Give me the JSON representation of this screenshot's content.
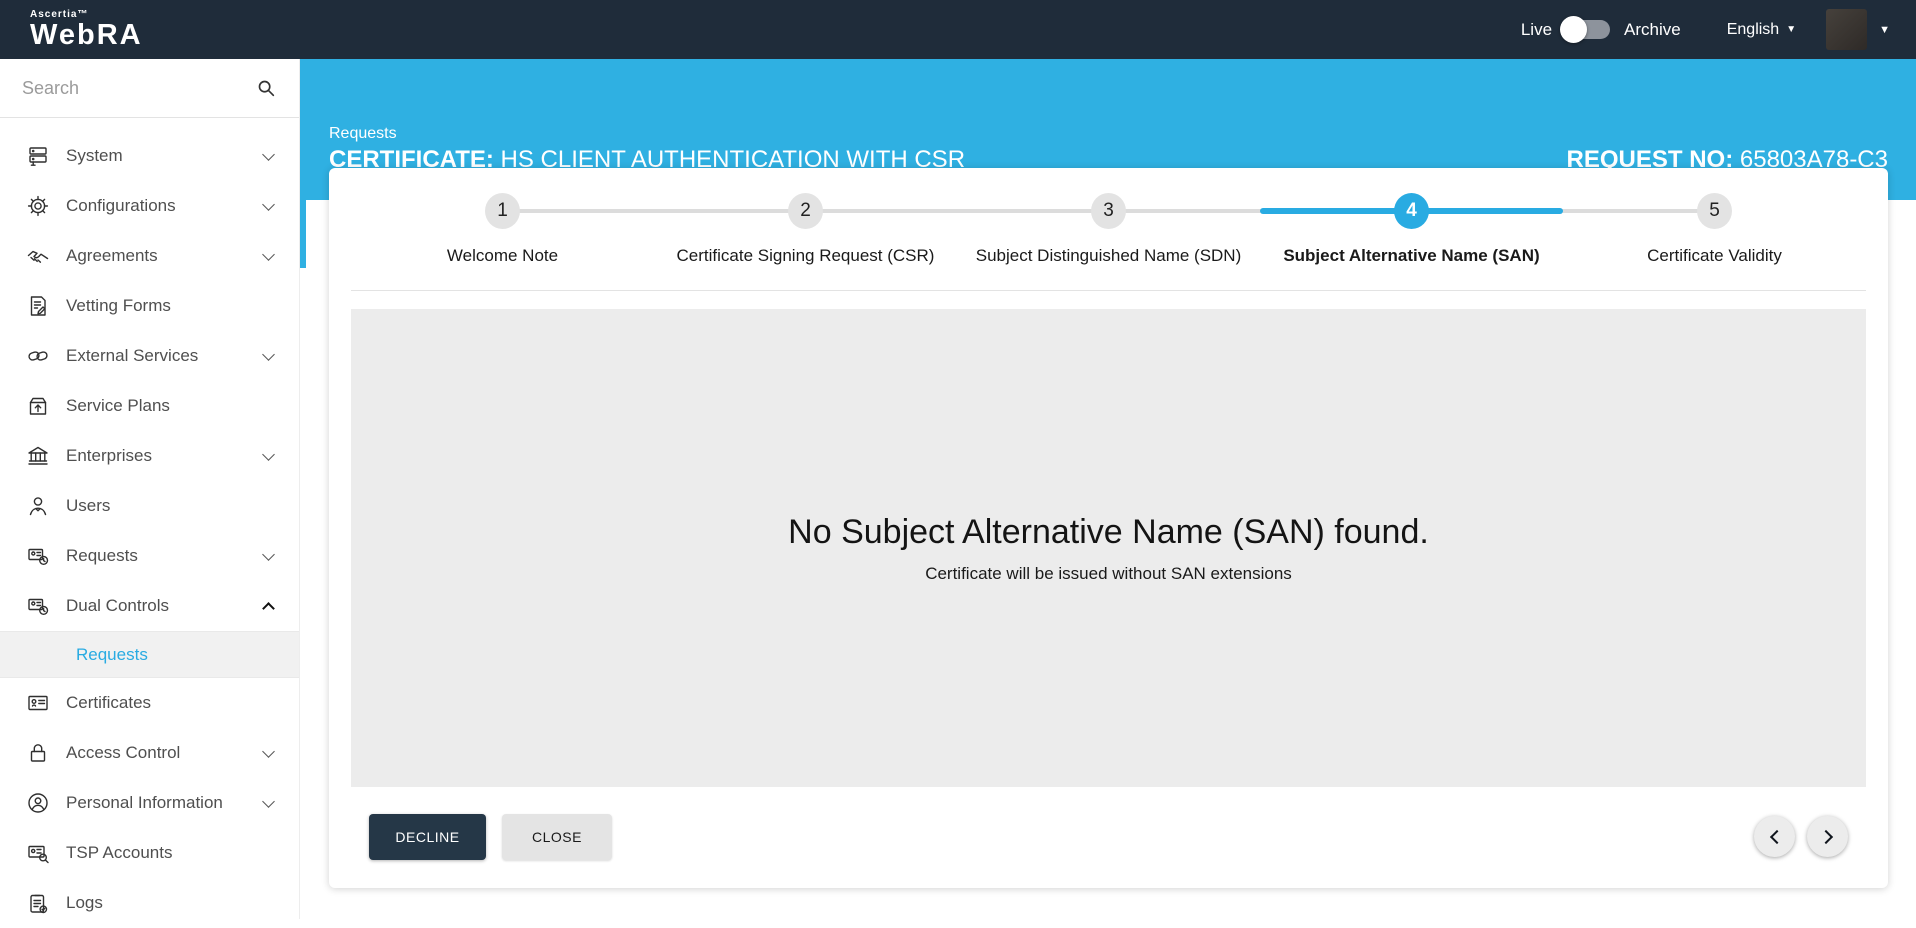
{
  "topbar": {
    "brand_small": "Ascertia™",
    "brand_large": "WebRA",
    "live_label": "Live",
    "archive_label": "Archive",
    "toggle_state": "live",
    "language": "English"
  },
  "sidebar": {
    "search_placeholder": "Search",
    "items": [
      {
        "label": "System",
        "icon": "server-icon",
        "chevron": "down"
      },
      {
        "label": "Configurations",
        "icon": "gear-icon",
        "chevron": "down"
      },
      {
        "label": "Agreements",
        "icon": "handshake-icon",
        "chevron": "down"
      },
      {
        "label": "Vetting Forms",
        "icon": "vetting-form-icon",
        "chevron": ""
      },
      {
        "label": "External Services",
        "icon": "link-icon",
        "chevron": "down"
      },
      {
        "label": "Service Plans",
        "icon": "service-plan-icon",
        "chevron": ""
      },
      {
        "label": "Enterprises",
        "icon": "bank-icon",
        "chevron": "down"
      },
      {
        "label": "Users",
        "icon": "user-icon",
        "chevron": ""
      },
      {
        "label": "Requests",
        "icon": "request-card-icon",
        "chevron": "down"
      },
      {
        "label": "Dual Controls",
        "icon": "request-card-icon",
        "chevron": "up",
        "expanded": true
      },
      {
        "label": "Requests",
        "sub": true,
        "active": true
      },
      {
        "label": "Certificates",
        "icon": "certificate-icon",
        "chevron": ""
      },
      {
        "label": "Access Control",
        "icon": "lock-icon",
        "chevron": "down"
      },
      {
        "label": "Personal Information",
        "icon": "person-circle-icon",
        "chevron": "down"
      },
      {
        "label": "TSP Accounts",
        "icon": "tsp-card-icon",
        "chevron": ""
      },
      {
        "label": "Logs",
        "icon": "logs-icon",
        "chevron": ""
      }
    ]
  },
  "header": {
    "breadcrumb": "Requests",
    "title_label": "CERTIFICATE:",
    "title_value": "HS CLIENT AUTHENTICATION WITH CSR",
    "request_no_label": "REQUEST NO:",
    "request_no_value": "65803A78-C3"
  },
  "stepper": {
    "steps": [
      {
        "number": "1",
        "label": "Welcome Note",
        "state": "inactive"
      },
      {
        "number": "2",
        "label": "Certificate Signing Request (CSR)",
        "state": "inactive"
      },
      {
        "number": "3",
        "label": "Subject Distinguished Name (SDN)",
        "state": "inactive"
      },
      {
        "number": "4",
        "label": "Subject Alternative Name (SAN)",
        "state": "active"
      },
      {
        "number": "5",
        "label": "Certificate Validity",
        "state": "inactive"
      }
    ]
  },
  "content": {
    "message_title": "No Subject Alternative Name (SAN) found.",
    "message_subtitle": "Certificate will be issued without SAN extensions"
  },
  "footer": {
    "decline_label": "DECLINE",
    "close_label": "CLOSE"
  },
  "colors": {
    "topbar_navy": "#1f2c3a",
    "accent_cyan": "#2fb0e2",
    "active_link_cyan": "#29abe2",
    "decline_navy": "#253747",
    "panel_gray": "#ececec",
    "step_inactive_gray": "#e3e3e3"
  }
}
